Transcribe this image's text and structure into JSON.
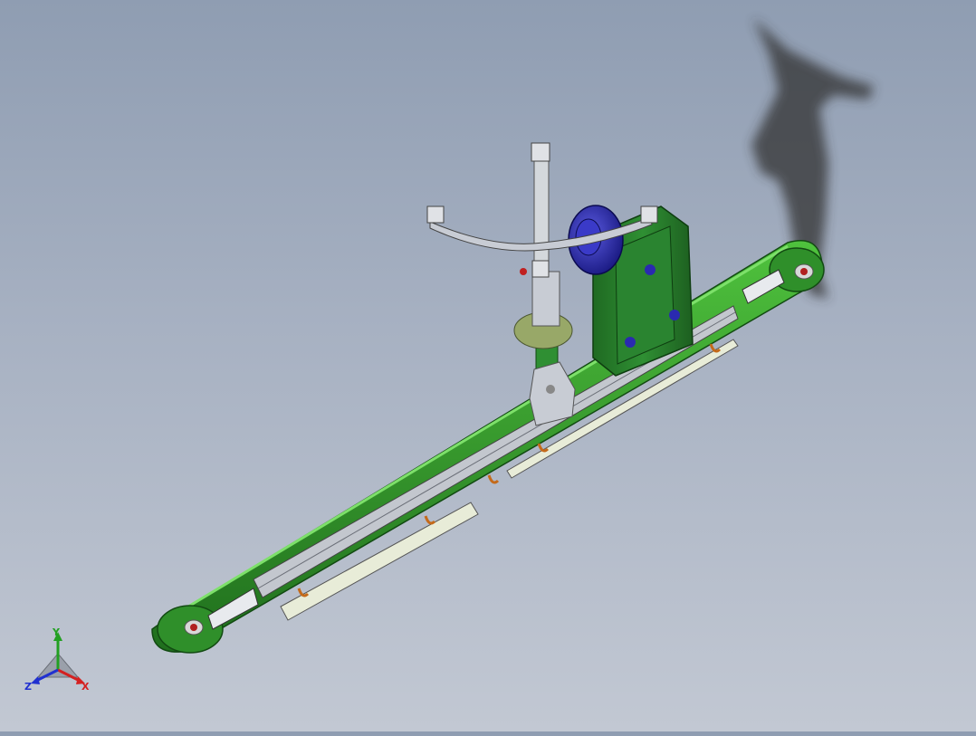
{
  "viewport": {
    "background_top": "#8f9db2",
    "background_bottom": "#c2c8d3",
    "model": {
      "beam_color": "#2f8f2a",
      "beam_highlight": "#47b53a",
      "gearbox_color": "#2b7a2e",
      "motor_color": "#2a2ab0",
      "rail_color": "#b8bcc4",
      "shadow_color": "#2b2b2b"
    }
  },
  "triad": {
    "x_label": "X",
    "y_label": "Y",
    "z_label": "Z",
    "x_color": "#d42020",
    "y_color": "#22a022",
    "z_color": "#2030d0"
  }
}
